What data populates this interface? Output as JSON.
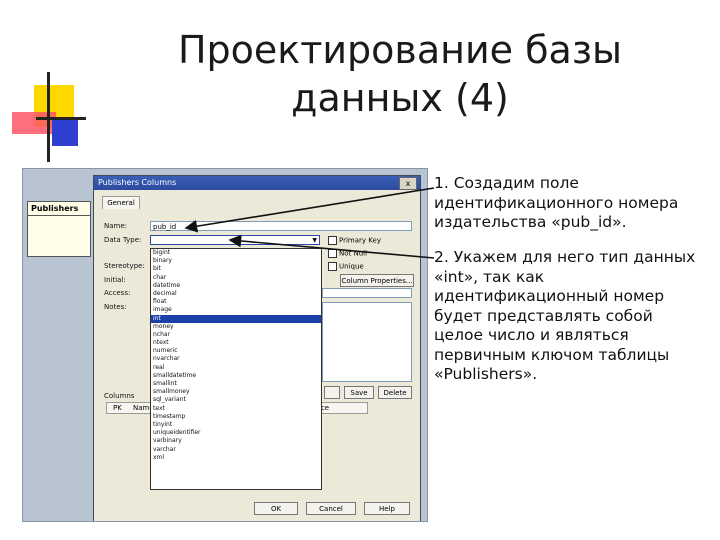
{
  "title": "Проектирование базы данных (4)",
  "bullets": [
    "1. Создадим поле идентификационного номера издательства «pub_id».",
    "2. Укажем для него тип данных «int», так как идентификационный номер будет представлять собой целое число и являться первичным ключом таблицы «Publishers»."
  ],
  "entity": {
    "name": "Publishers"
  },
  "dialog": {
    "title": "Publishers Columns",
    "close": "x",
    "tab": "General",
    "labels": {
      "name": "Name:",
      "data_type": "Data Type:",
      "stereotype": "Stereotype:",
      "initial": "Initial:",
      "access": "Access:",
      "notes": "Notes:",
      "columns": "Columns"
    },
    "name_value": "pub_id",
    "checkboxes": {
      "primary_key": "Primary Key",
      "not_null": "Not Null",
      "unique": "Unique"
    },
    "column_properties_button": "Column Properties...",
    "save_button": "Save",
    "delete_button": "Delete",
    "grid_headers": {
      "pk": "PK",
      "name": "Name",
      "ice": "ice"
    },
    "buttons": {
      "ok": "OK",
      "cancel": "Cancel",
      "help": "Help"
    },
    "type_options": [
      "bigint",
      "binary",
      "bit",
      "char",
      "datetime",
      "decimal",
      "float",
      "image",
      "int",
      "money",
      "nchar",
      "ntext",
      "numeric",
      "nvarchar",
      "real",
      "smalldatetime",
      "smallint",
      "smallmoney",
      "sql_variant",
      "text",
      "timestamp",
      "tinyint",
      "uniqueidentifier",
      "varbinary",
      "varchar",
      "xml"
    ],
    "selected_type": "int"
  }
}
